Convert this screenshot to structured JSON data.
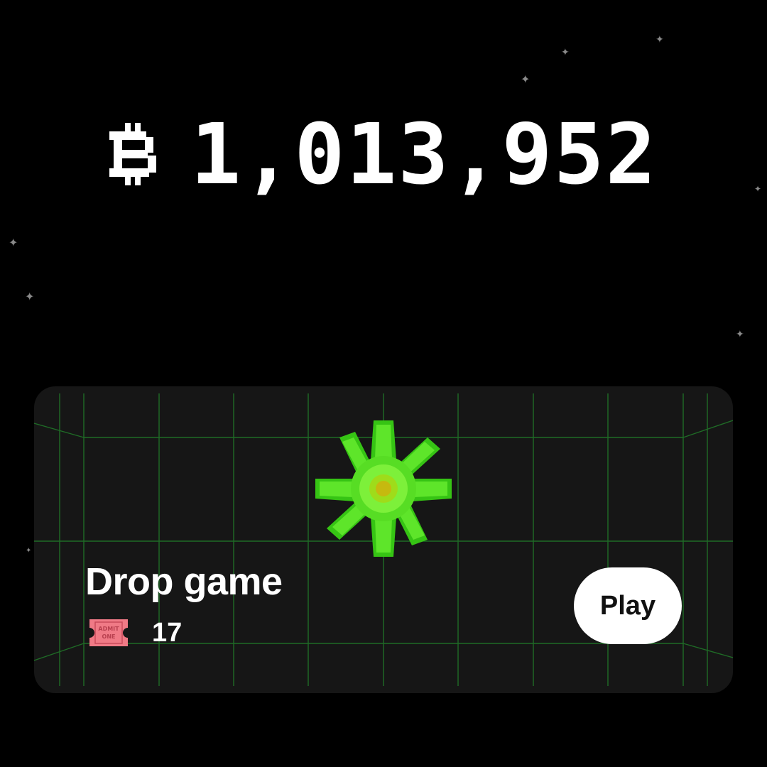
{
  "balance": {
    "currency_icon": "bitcoin-icon",
    "amount": "1,013,952"
  },
  "game_card": {
    "title": "Drop game",
    "gem_icon": "green-gem-icon",
    "ticket_icon": "admit-one-ticket-icon",
    "ticket_icon_text": "ADMIT ONE",
    "ticket_count": "17",
    "play_label": "Play"
  },
  "colors": {
    "background": "#000000",
    "card": "#161616",
    "grid_line": "#1f6b26",
    "gem_green": "#4fe11d",
    "ticket_pink": "#f07a86",
    "button": "#ffffff"
  }
}
